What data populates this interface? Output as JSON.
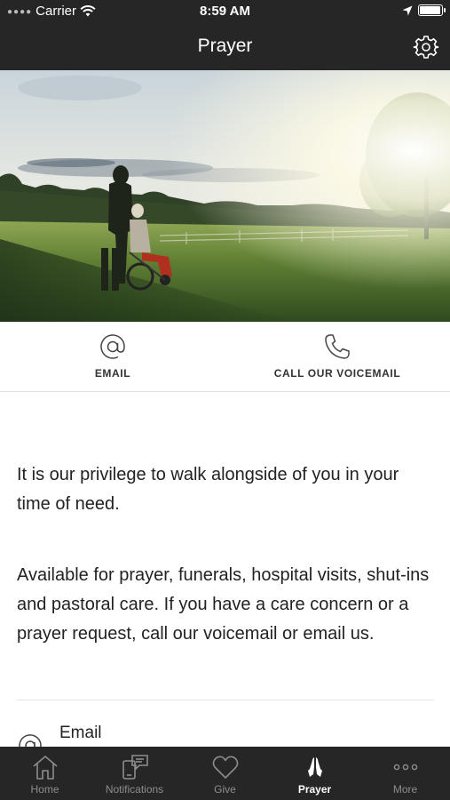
{
  "status_bar": {
    "carrier": "Carrier",
    "time": "8:59 AM",
    "battery_level": 0.95
  },
  "nav": {
    "title": "Prayer",
    "settings_icon": "gear-icon"
  },
  "actions": [
    {
      "icon": "at-sign-icon",
      "label": "EMAIL"
    },
    {
      "icon": "phone-icon",
      "label": "CALL OUR VOICEMAIL"
    }
  ],
  "content": {
    "paragraph_1": "It is our privilege to walk alongside of you in your time of need.",
    "paragraph_2": "Available for prayer, funerals, hospital visits, shut-ins and pastoral care. If you have a care concern or a prayer request, call our voicemail or email us."
  },
  "contact_list": {
    "email_label": "Email"
  },
  "tabs": [
    {
      "icon": "home-icon",
      "label": "Home",
      "active": false
    },
    {
      "icon": "notifications-icon",
      "label": "Notifications",
      "active": false
    },
    {
      "icon": "heart-icon",
      "label": "Give",
      "active": false
    },
    {
      "icon": "praying-hands-icon",
      "label": "Prayer",
      "active": true
    },
    {
      "icon": "more-dots-icon",
      "label": "More",
      "active": false
    }
  ],
  "colors": {
    "bar_background": "#262626",
    "tab_inactive": "#8d8d8d",
    "tab_active": "#ffffff"
  }
}
